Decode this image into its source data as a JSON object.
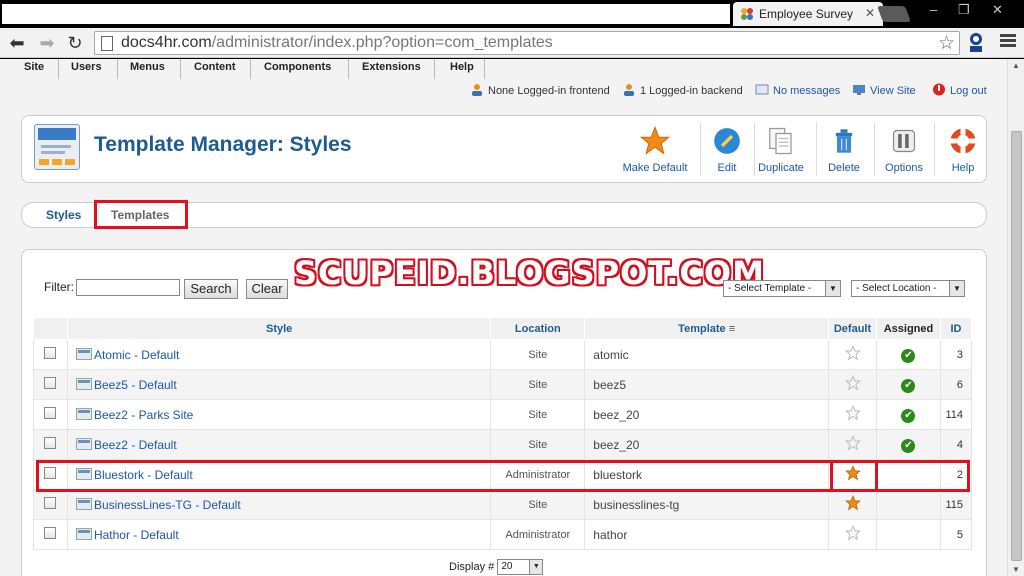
{
  "browser": {
    "tab_title": "Employee Survey",
    "url_host": "docs4hr.com",
    "url_path": "/administrator/index.php?option=com_templates",
    "window_controls": [
      "–",
      "❐",
      "✕"
    ]
  },
  "menubar": [
    "Site",
    "Users",
    "Menus",
    "Content",
    "Components",
    "Extensions",
    "Help"
  ],
  "status": {
    "frontend": "None Logged-in frontend",
    "backend": "1 Logged-in backend",
    "messages": "No messages",
    "view_site": "View Site",
    "logout": "Log out"
  },
  "header": {
    "title": "Template Manager: Styles"
  },
  "toolbar": {
    "make_default": "Make Default",
    "edit": "Edit",
    "duplicate": "Duplicate",
    "delete": "Delete",
    "options": "Options",
    "help": "Help"
  },
  "subtabs": {
    "styles": "Styles",
    "templates": "Templates"
  },
  "watermark": "SCUPEID.BLOGSPOT.COM",
  "filter": {
    "label": "Filter:",
    "value": "",
    "search": "Search",
    "clear": "Clear",
    "select_template": "- Select Template -",
    "select_location": "- Select Location -"
  },
  "columns": {
    "style": "Style",
    "location": "Location",
    "template": "Template",
    "default": "Default",
    "assigned": "Assigned",
    "id": "ID"
  },
  "rows": [
    {
      "style": "Atomic - Default",
      "location": "Site",
      "template": "atomic",
      "default": false,
      "assigned": true,
      "id": "3"
    },
    {
      "style": "Beez5 - Default",
      "location": "Site",
      "template": "beez5",
      "default": false,
      "assigned": true,
      "id": "6"
    },
    {
      "style": "Beez2 - Parks Site",
      "location": "Site",
      "template": "beez_20",
      "default": false,
      "assigned": true,
      "id": "114"
    },
    {
      "style": "Beez2 - Default",
      "location": "Site",
      "template": "beez_20",
      "default": false,
      "assigned": true,
      "id": "4"
    },
    {
      "style": "Bluestork - Default",
      "location": "Administrator",
      "template": "bluestork",
      "default": true,
      "assigned": false,
      "id": "2"
    },
    {
      "style": "BusinessLines-TG - Default",
      "location": "Site",
      "template": "businesslines-tg",
      "default": true,
      "assigned": false,
      "id": "115"
    },
    {
      "style": "Hathor - Default",
      "location": "Administrator",
      "template": "hathor",
      "default": false,
      "assigned": false,
      "id": "5"
    }
  ],
  "pagination": {
    "display_label": "Display #",
    "display_value": "20"
  },
  "colors": {
    "accent": "#1e5b8e",
    "link": "#1b57b1",
    "highlight": "#e0101c",
    "star_on": "#f08a1c",
    "check": "#2b8a19"
  }
}
